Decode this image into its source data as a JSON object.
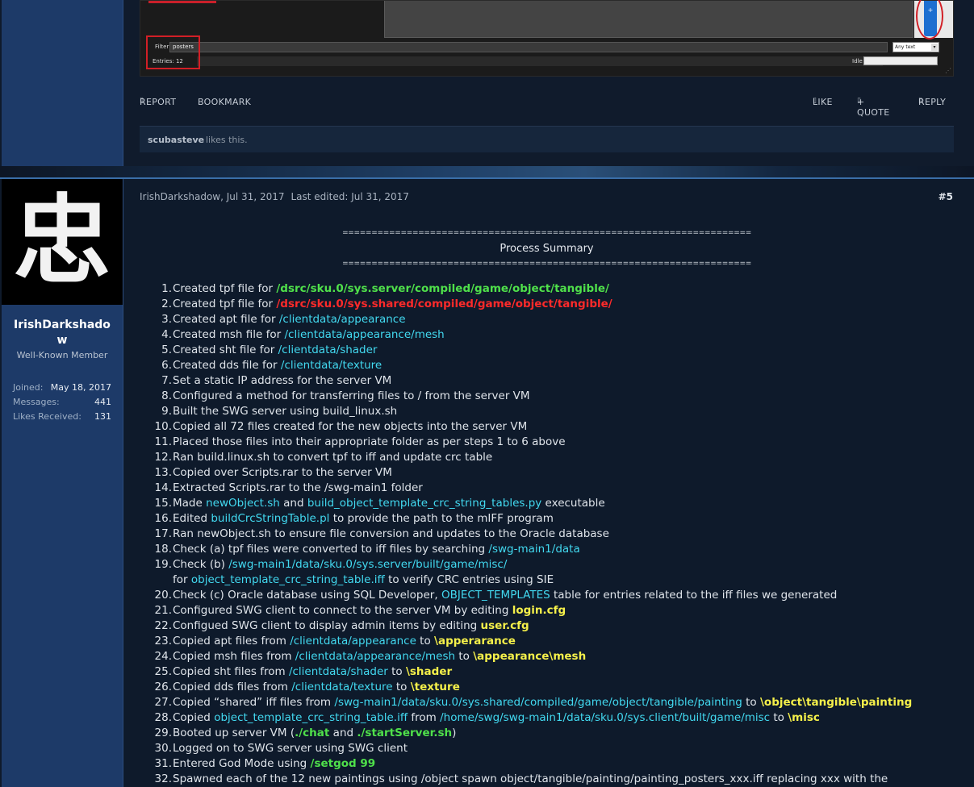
{
  "post1": {
    "screenshot": {
      "filter_label": "Filter",
      "filter_value": "posters",
      "select_value": "Any text",
      "select_arrow": "▾",
      "entries_label": "Entries: 12",
      "idle_label": "Idle",
      "scroll_button": "+"
    },
    "actions": {
      "report": "REPORT",
      "bookmark": "BOOKMARK",
      "like": "LIKE",
      "quote": "+ QUOTE",
      "reply": "REPLY",
      "icon_glyph": "▯"
    },
    "likes": {
      "user": "scubasteve",
      "text": "likes this."
    }
  },
  "post2": {
    "author": {
      "avatar_char": "忠",
      "username": "IrishDarkshadow",
      "title": "Well-Known Member",
      "stats": [
        {
          "label": "Joined:",
          "value": "May 18, 2017"
        },
        {
          "label": "Messages:",
          "value": "441"
        },
        {
          "label": "Likes Received:",
          "value": "131"
        }
      ]
    },
    "meta": {
      "author_date": "IrishDarkshadow, Jul 31, 2017",
      "edited": "Last edited: Jul 31, 2017",
      "number": "#5"
    },
    "summary": {
      "rule": "======================================================================",
      "title": "Process Summary"
    },
    "steps": [
      {
        "n": "1.",
        "parts": [
          [
            "",
            "Created tpf file for "
          ],
          [
            "g",
            "/dsrc/sku.0/sys.server/compiled/game/object/tangible/"
          ]
        ]
      },
      {
        "n": "2.",
        "parts": [
          [
            "",
            "Created tpf file for "
          ],
          [
            "r",
            "/dsrc/sku.0/sys.shared/compiled/game/object/tangible/"
          ]
        ]
      },
      {
        "n": "3.",
        "parts": [
          [
            "",
            "Created apt file for "
          ],
          [
            "c",
            "/clientdata/appearance"
          ]
        ]
      },
      {
        "n": "4.",
        "parts": [
          [
            "",
            "Created msh file for "
          ],
          [
            "c",
            "/clientdata/appearance/mesh"
          ]
        ]
      },
      {
        "n": "5.",
        "parts": [
          [
            "",
            "Created sht file for "
          ],
          [
            "c",
            "/clientdata/shader"
          ]
        ]
      },
      {
        "n": "6.",
        "parts": [
          [
            "",
            "Created dds file for "
          ],
          [
            "c",
            "/clientdata/texture"
          ]
        ]
      },
      {
        "n": "7.",
        "parts": [
          [
            "",
            "Set a static IP address for the server VM"
          ]
        ]
      },
      {
        "n": "8.",
        "parts": [
          [
            "",
            "Configured a method for transferring files to / from the server VM"
          ]
        ]
      },
      {
        "n": "9.",
        "parts": [
          [
            "",
            "Built the SWG server using build_linux.sh"
          ]
        ]
      },
      {
        "n": "10.",
        "parts": [
          [
            "",
            "Copied all 72 files created for the new objects into the server VM"
          ]
        ]
      },
      {
        "n": "11.",
        "parts": [
          [
            "",
            "Placed those files into their appropriate folder as per steps 1 to 6 above"
          ]
        ]
      },
      {
        "n": "12.",
        "parts": [
          [
            "",
            "Ran build.linux.sh to convert tpf to iff and update crc table"
          ]
        ]
      },
      {
        "n": "13.",
        "parts": [
          [
            "",
            "Copied over Scripts.rar to the server VM"
          ]
        ]
      },
      {
        "n": "14.",
        "parts": [
          [
            "",
            "Extracted Scripts.rar to the /swg-main1 folder"
          ]
        ]
      },
      {
        "n": "15.",
        "parts": [
          [
            "",
            "Made "
          ],
          [
            "c",
            "newObject.sh"
          ],
          [
            "",
            " and "
          ],
          [
            "c",
            "build_object_template_crc_string_tables.py"
          ],
          [
            "",
            " executable"
          ]
        ]
      },
      {
        "n": "16.",
        "parts": [
          [
            "",
            "Edited "
          ],
          [
            "c",
            "buildCrcStringTable.pl"
          ],
          [
            "",
            " to provide the path to the mIFF program"
          ]
        ]
      },
      {
        "n": "17.",
        "parts": [
          [
            "",
            "Ran newObject.sh to ensure file conversion and updates to the Oracle database"
          ]
        ]
      },
      {
        "n": "18.",
        "parts": [
          [
            "",
            "Check (a) tpf files were converted to iff files by searching "
          ],
          [
            "c",
            "/swg-main1/data"
          ]
        ]
      },
      {
        "n": "19.",
        "parts": [
          [
            "",
            "Check (b) "
          ],
          [
            "c",
            "/swg-main1/data/sku.0/sys.server/built/game/misc/"
          ]
        ],
        "parts2": [
          [
            "",
            "for "
          ],
          [
            "c",
            "object_template_crc_string_table.iff"
          ],
          [
            "",
            " to verify CRC entries using SIE"
          ]
        ]
      },
      {
        "n": "20.",
        "parts": [
          [
            "",
            "Check (c) Oracle database using SQL Developer, "
          ],
          [
            "c",
            "OBJECT_TEMPLATES"
          ],
          [
            "",
            " table for entries related to the iff files we generated"
          ]
        ]
      },
      {
        "n": "21.",
        "parts": [
          [
            "",
            "Configured SWG client to connect to the server VM by editing "
          ],
          [
            "y",
            "login.cfg"
          ]
        ]
      },
      {
        "n": "22.",
        "parts": [
          [
            "",
            "Configued SWG client to display admin items by editing "
          ],
          [
            "y",
            "user.cfg"
          ]
        ]
      },
      {
        "n": "23.",
        "parts": [
          [
            "",
            "Copied apt files from "
          ],
          [
            "c",
            "/clientdata/appearance"
          ],
          [
            "",
            " to "
          ],
          [
            "y",
            "\\apperarance"
          ]
        ]
      },
      {
        "n": "24.",
        "parts": [
          [
            "",
            "Copied msh files from "
          ],
          [
            "c",
            "/clientdata/appearance/mesh"
          ],
          [
            "",
            " to "
          ],
          [
            "y",
            "\\appearance\\mesh"
          ]
        ]
      },
      {
        "n": "25.",
        "parts": [
          [
            "",
            "Copied sht files from "
          ],
          [
            "c",
            "/clientdata/shader"
          ],
          [
            "",
            " to "
          ],
          [
            "y",
            "\\shader"
          ]
        ]
      },
      {
        "n": "26.",
        "parts": [
          [
            "",
            "Copied dds files from "
          ],
          [
            "c",
            "/clientdata/texture"
          ],
          [
            "",
            " to "
          ],
          [
            "y",
            "\\texture"
          ]
        ]
      },
      {
        "n": "27.",
        "parts": [
          [
            "",
            "Copied “shared” iff files from "
          ],
          [
            "c",
            "/swg-main1/data/sku.0/sys.shared/compiled/game/object/tangible/painting"
          ],
          [
            "",
            " to "
          ],
          [
            "y",
            "\\object\\tangible\\painting"
          ]
        ]
      },
      {
        "n": "28.",
        "parts": [
          [
            "",
            "Copied "
          ],
          [
            "c",
            "object_template_crc_string_table.iff"
          ],
          [
            "",
            " from "
          ],
          [
            "c",
            "/home/swg/swg-main1/data/sku.0/sys.client/built/game/misc"
          ],
          [
            "",
            " to "
          ],
          [
            "y",
            "\\misc"
          ]
        ]
      },
      {
        "n": "29.",
        "parts": [
          [
            "",
            "Booted up server VM ("
          ],
          [
            "g",
            "./chat"
          ],
          [
            "",
            " and "
          ],
          [
            "g",
            "./startServer.sh"
          ],
          [
            "",
            ")"
          ]
        ]
      },
      {
        "n": "30.",
        "parts": [
          [
            "",
            "Logged on to SWG server using SWG client"
          ]
        ]
      },
      {
        "n": "31.",
        "parts": [
          [
            "",
            "Entered God Mode using "
          ],
          [
            "g",
            "/setgod 99"
          ]
        ]
      },
      {
        "n": "32.",
        "parts": [
          [
            "",
            "Spawned each of the 12 new paintings using /object spawn object/tangible/painting/painting_posters_xxx.iff replacing xxx with the"
          ]
        ]
      }
    ]
  }
}
